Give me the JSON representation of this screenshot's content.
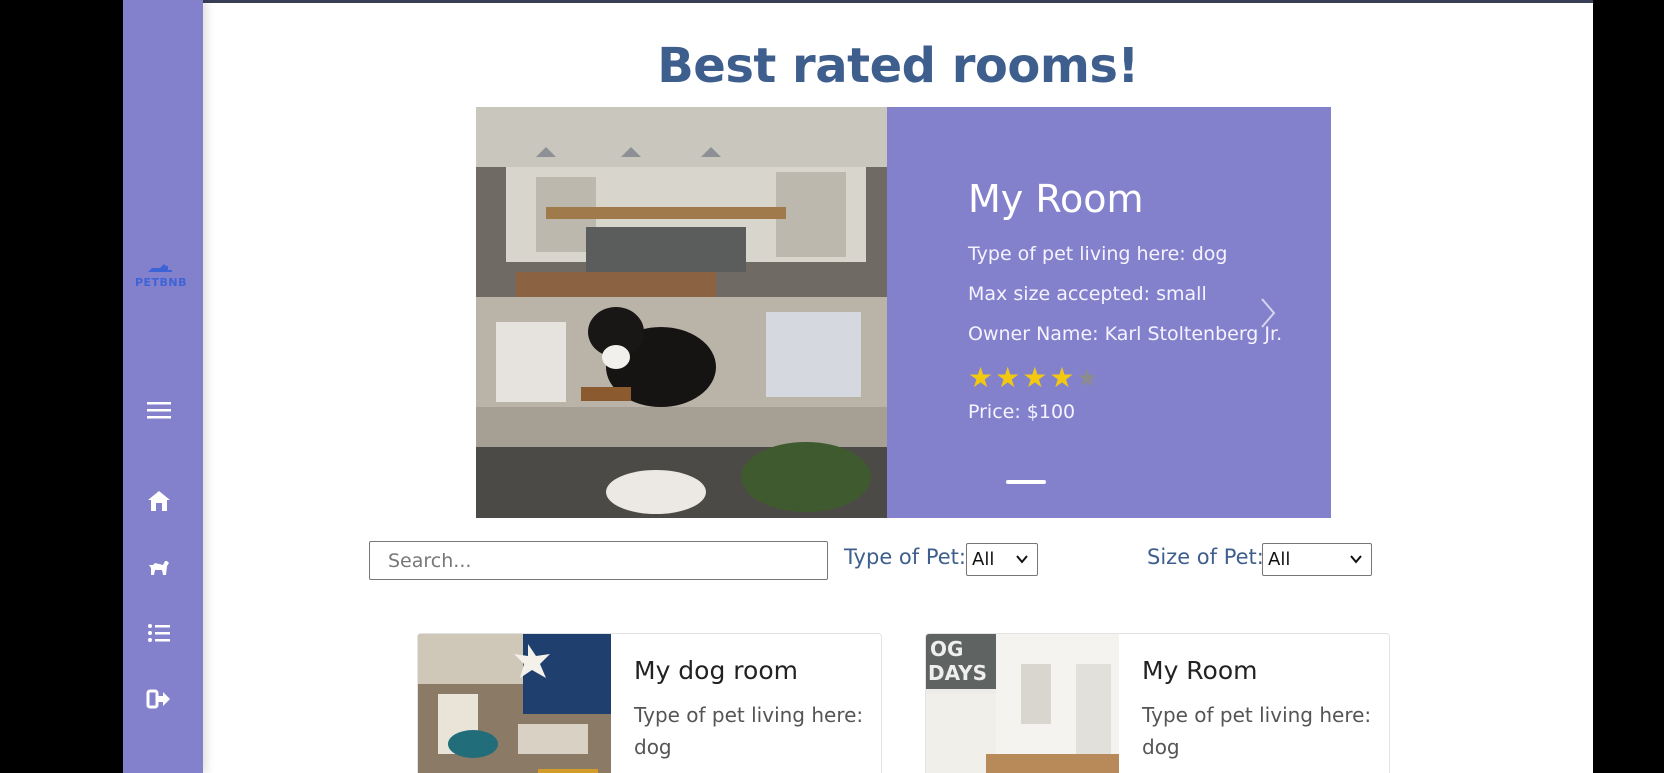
{
  "page": {
    "title": "Best rated rooms!"
  },
  "sidebar": {
    "logo_text": "PETBNB",
    "icons": [
      "menu-icon",
      "home-icon",
      "pet-icon",
      "list-icon",
      "logout-icon"
    ]
  },
  "carousel": {
    "title": "My Room",
    "pet_type": "Type of pet living here: dog",
    "max_size": "Max size accepted: small",
    "owner": "Owner Name: Karl Stoltenberg Jr.",
    "rating": 4,
    "rating_max": 5,
    "price": "Price: $100"
  },
  "filters": {
    "search_placeholder": "Search...",
    "type_label": "Type of Pet:",
    "type_value": "All",
    "size_label": "Size of Pet:",
    "size_value": "All"
  },
  "cards": [
    {
      "title": "My dog room",
      "pet_type": "Type of pet living here: dog"
    },
    {
      "title": "My Room",
      "pet_type": "Type of pet living here: dog"
    }
  ],
  "colors": {
    "sidebar": "#8481cc",
    "title": "#3e5f8d",
    "star": "#f2c811"
  }
}
